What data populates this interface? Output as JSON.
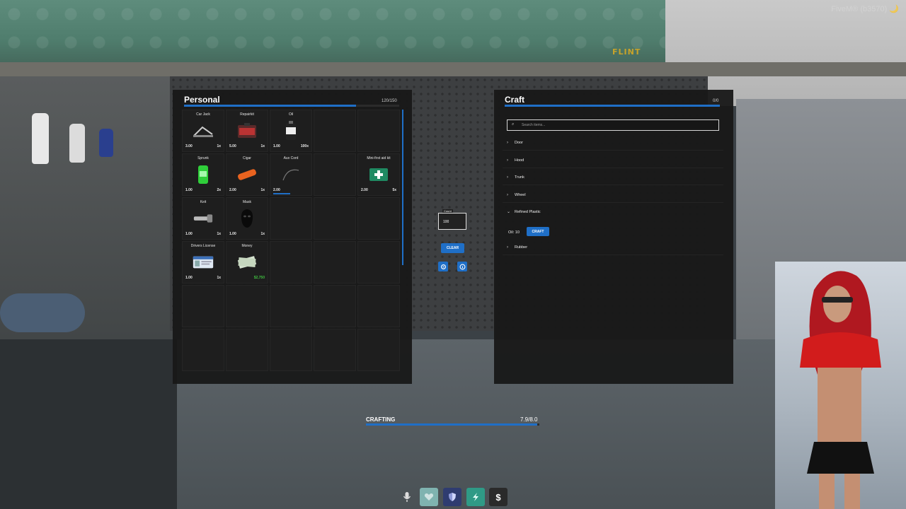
{
  "watermark": "FiveM® (b3570) 🌙",
  "scene_sign": "FLINT",
  "inventory": {
    "title": "Personal",
    "weight": "120/150",
    "weight_fraction": 0.8,
    "items": [
      {
        "name": "Car Jack",
        "weight": "3.00",
        "qty": "1x",
        "icon": "car-jack-icon"
      },
      {
        "name": "Repairkit",
        "weight": "5.00",
        "qty": "1x",
        "icon": "repair-kit-icon"
      },
      {
        "name": "Oil",
        "weight": "1.00",
        "qty": "100x",
        "icon": "oil-can-icon"
      },
      {
        "name": "",
        "weight": "",
        "qty": "",
        "icon": ""
      },
      {
        "name": "",
        "weight": "",
        "qty": "",
        "icon": ""
      },
      {
        "name": "Sprunk",
        "weight": "1.00",
        "qty": "2x",
        "icon": "sprunk-can-icon"
      },
      {
        "name": "Cigar",
        "weight": "2.00",
        "qty": "1x",
        "icon": "cigar-icon"
      },
      {
        "name": "Aux Cord",
        "weight": "2.00",
        "qty": "",
        "icon": "aux-cord-icon",
        "durability": 0.75
      },
      {
        "name": "",
        "weight": "",
        "qty": "",
        "icon": ""
      },
      {
        "name": "Mini-first aid kit",
        "weight": "2.00",
        "qty": "5x",
        "icon": "first-aid-icon"
      },
      {
        "name": "Keit",
        "weight": "1.00",
        "qty": "1x",
        "icon": "keit-icon"
      },
      {
        "name": "Mask",
        "weight": "1.00",
        "qty": "1x",
        "icon": "mask-icon"
      },
      {
        "name": "",
        "weight": "",
        "qty": "",
        "icon": ""
      },
      {
        "name": "",
        "weight": "",
        "qty": "",
        "icon": ""
      },
      {
        "name": "",
        "weight": "",
        "qty": "",
        "icon": ""
      },
      {
        "name": "Drivers License",
        "weight": "1.00",
        "qty": "1x",
        "icon": "license-icon"
      },
      {
        "name": "Money",
        "weight": "",
        "qty": "$2,750",
        "icon": "money-icon",
        "money": true
      }
    ]
  },
  "controls": {
    "count_label": "Count",
    "count_value": "100",
    "clear_label": "CLEAR"
  },
  "craft": {
    "title": "Craft",
    "count": "0/0",
    "search_placeholder": "Search items...",
    "categories": [
      "Door",
      "Hood",
      "Trunk",
      "Wheel",
      "Refined Plastic",
      "Rubber"
    ],
    "expanded": "Refined Plastic",
    "recipe_requirement": "Oil: 10",
    "craft_button": "CRAFT"
  },
  "progress": {
    "label": "CRAFTING",
    "value": "7.9/8.0",
    "fraction": 0.9875
  },
  "hud": {
    "icons": [
      "microphone-icon",
      "health-icon",
      "armor-icon",
      "stamina-icon",
      "money-icon"
    ],
    "colors": {
      "health": "#7fb3b0",
      "armor": "#2f3c70",
      "stamina": "#2f9a86",
      "money": "#2a2a2a"
    }
  },
  "colors": {
    "accent": "#1f6fc7",
    "panel": "#181818",
    "money_text": "#3fbf3f"
  }
}
